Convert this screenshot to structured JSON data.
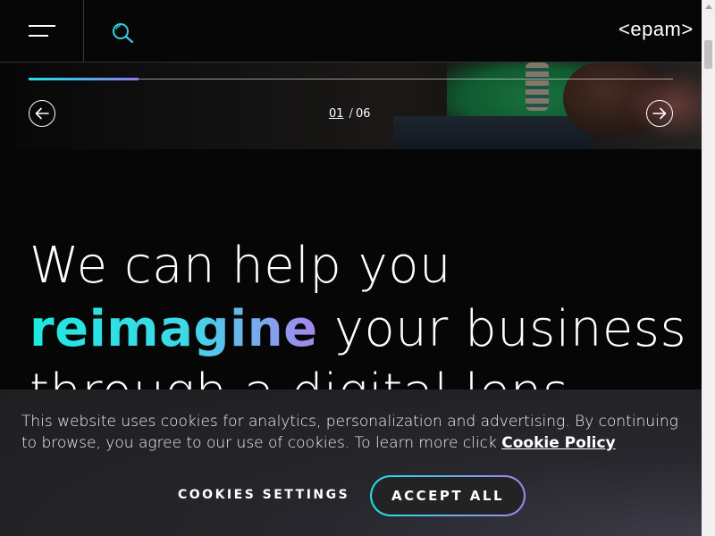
{
  "header": {
    "logo_text": "<epam>",
    "menu_icon": "hamburger-menu-icon",
    "search_icon": "search-icon"
  },
  "slider": {
    "current": "01",
    "total": "06",
    "progress": 0.17,
    "prev_icon": "arrow-left-icon",
    "next_icon": "arrow-right-icon"
  },
  "headline": {
    "line1": "We can help you",
    "accent": "reimagine",
    "line2_rest": " your business",
    "line3": "through a digital lens"
  },
  "cookie_banner": {
    "text": "This website uses cookies for analytics, personalization and advertising. By continuing to browse, you agree to our use of cookies. To learn more click ",
    "link_text": "Cookie Policy",
    "settings_label": "COOKIES SETTINGS",
    "accept_label": "ACCEPT ALL"
  },
  "colors": {
    "accent_start": "#1de3e3",
    "accent_end": "#a883ee",
    "background": "#060606",
    "banner": "#232326"
  }
}
